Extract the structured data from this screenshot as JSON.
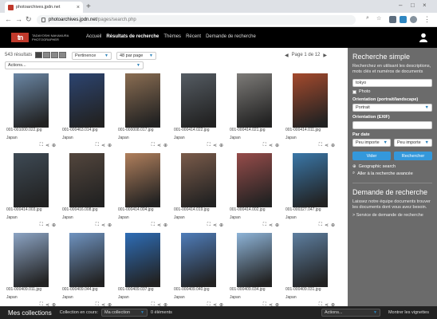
{
  "browser": {
    "tab_title": "photoarchives.jpdn.net",
    "url_host": "photoarchives.jpdn.net",
    "url_path": "/pages/search.php"
  },
  "site": {
    "logo_mark": "tn",
    "logo_line1": "TADAYOSHI NAKAMURA",
    "logo_line2": "PHOTOGRAPHER",
    "menu": [
      "Accueil",
      "Résultats de recherche",
      "Thèmes",
      "Récent",
      "Demande de recherche"
    ]
  },
  "results": {
    "count": "543 résultats",
    "sort": "Pertinence",
    "per_page": "48 par page",
    "actions": "Actions...",
    "page_label": "Page 1 de 12"
  },
  "items": [
    {
      "file": "001-001000.022.jpg",
      "loc": "Japan",
      "bg": "#6a86a4",
      "w": 44
    },
    {
      "file": "001-000463.014.jpg",
      "loc": "Japan",
      "bg": "#2c4470",
      "w": 44
    },
    {
      "file": "001-000008.017.jpg",
      "loc": "Japan",
      "bg": "#8a6d52",
      "w": 44
    },
    {
      "file": "001-000414.022.jpg",
      "loc": "Japan",
      "bg": "#555c63",
      "w": 44
    },
    {
      "file": "001-000414.021.jpg",
      "loc": "Japan",
      "bg": "#7d7b78",
      "w": 44
    },
    {
      "file": "001-000414.011.jpg",
      "loc": "Japan",
      "bg": "#a44a2d",
      "w": 44
    },
    {
      "file": "001-000414.003.jpg",
      "loc": "Japan",
      "bg": "#3e4a55",
      "w": 44
    },
    {
      "file": "001-000416.008.jpg",
      "loc": "Japan",
      "bg": "#53463d",
      "w": 44
    },
    {
      "file": "001-000414.004.jpg",
      "loc": "Japan",
      "bg": "#b07f5c",
      "w": 44
    },
    {
      "file": "001-000414.019.jpg",
      "loc": "Japan",
      "bg": "#7a5b4a",
      "w": 44
    },
    {
      "file": "001-000414.002.jpg",
      "loc": "Japan",
      "bg": "#964c4a",
      "w": 44
    },
    {
      "file": "001-000327.047.jpg",
      "loc": "Japan",
      "bg": "#3a77a8",
      "w": 44
    },
    {
      "file": "001-000409.011.jpg",
      "loc": "Japan",
      "bg": "#8ca4c4",
      "w": 44
    },
    {
      "file": "001-000409.044.jpg",
      "loc": "Japan",
      "bg": "#6f93c0",
      "w": 44
    },
    {
      "file": "001-000409.037.jpg",
      "loc": "Japan",
      "bg": "#2e6db6",
      "w": 44
    },
    {
      "file": "001-000409.040.jpg",
      "loc": "Japan",
      "bg": "#4f7dba",
      "w": 44
    },
    {
      "file": "001-000409.034.jpg",
      "loc": "Japan",
      "bg": "#8eb4d8",
      "w": 44
    },
    {
      "file": "001-000409.031.jpg",
      "loc": "Japan",
      "bg": "#5e7fa0",
      "w": 44
    }
  ],
  "sidebar": {
    "search_title": "Recherche simple",
    "search_desc": "Recherchez en utilisant les descriptions, mots clés et numéros de documents",
    "query": "tokyo",
    "photo_label": "Photo",
    "orientation_label": "Orientation (portrait/landscape)",
    "orientation_value": "Portrait",
    "exif_label": "Orientation (EXIF)",
    "date_label": "Par date",
    "date1": "Peu importe",
    "date2": "Peu importe",
    "clear_btn": "Vider",
    "search_btn": "Rechercher",
    "geo_link": "Geographic search",
    "advanced_link": "Aller à la recherche avancée",
    "request_title": "Demande de recherche",
    "request_desc": "Laissez notre équipe documents trouver les documents dont vous avez besoin.",
    "request_link": "> Service de demande de recherche"
  },
  "collections": {
    "title": "Mes collections",
    "current_label": "Collection en cours:",
    "current_value": "Ma collection",
    "elements": "0 éléments",
    "actions": "Actions...",
    "show_thumbs": "Montrer les vignettes"
  },
  "accent": "#3498db",
  "brand": "#c0392b"
}
